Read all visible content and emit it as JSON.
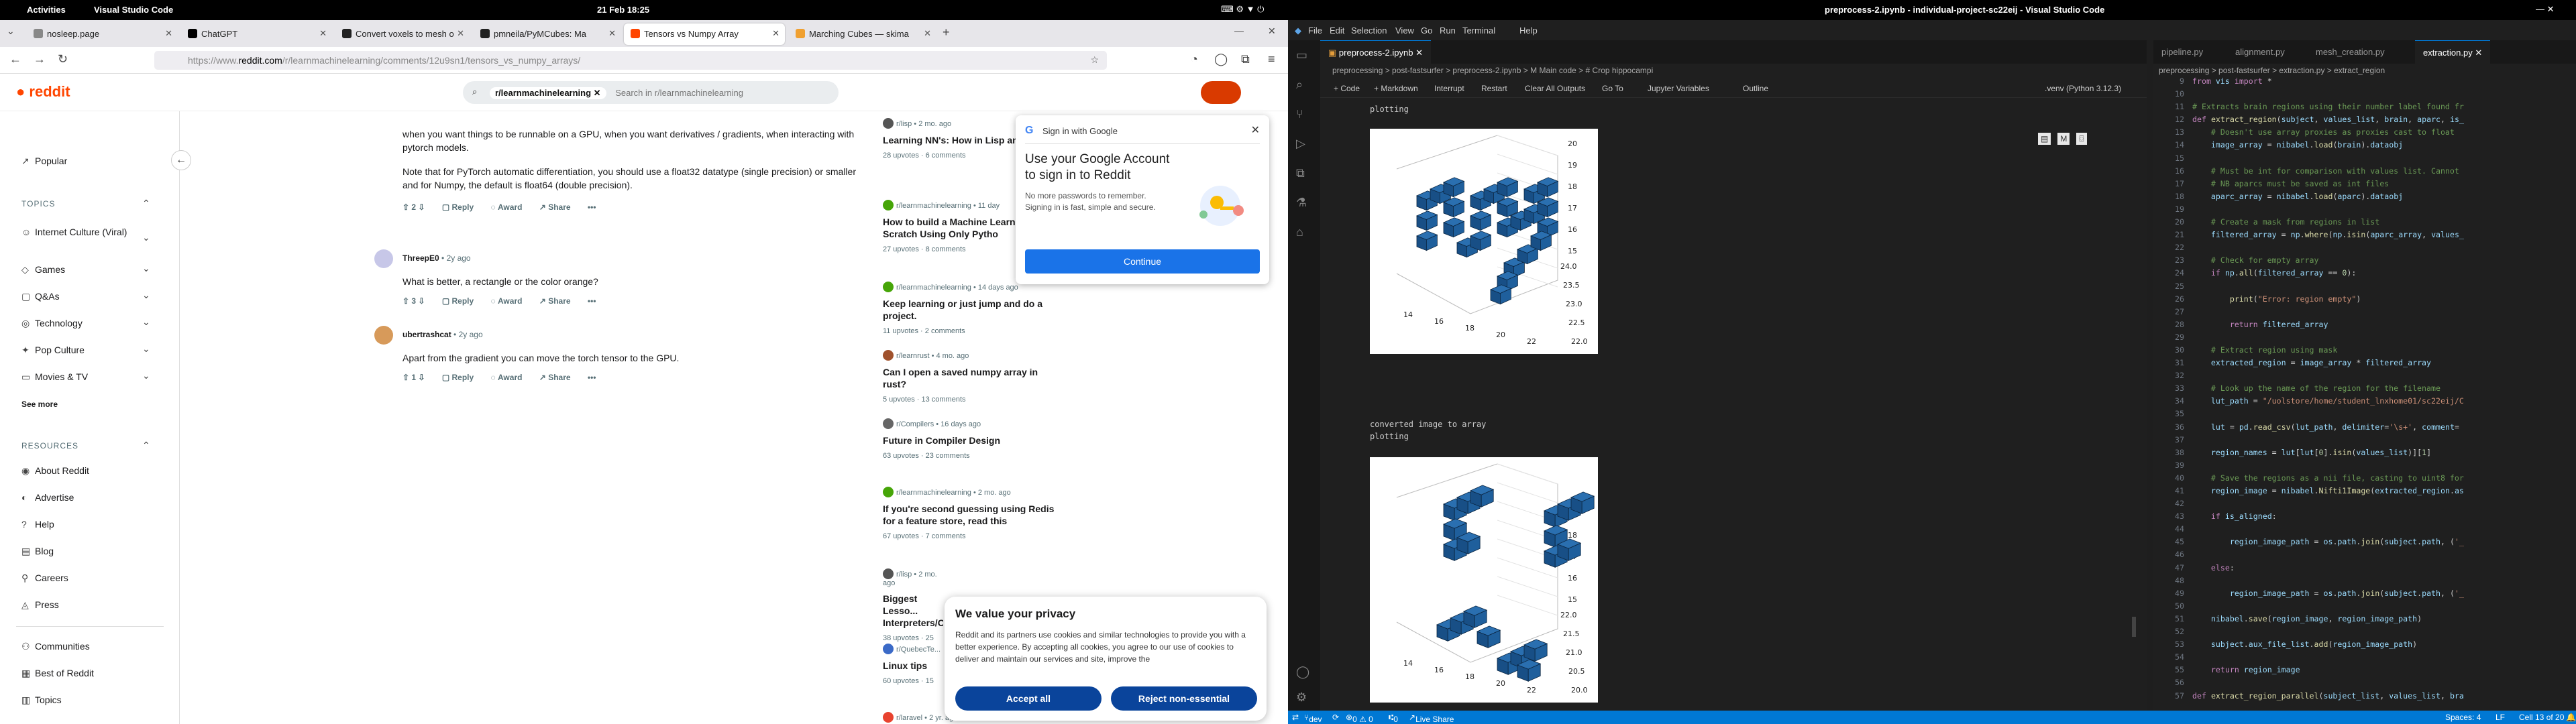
{
  "topbar": {
    "activities": "Activities",
    "app_name": "Visual Studio Code",
    "clock": "21 Feb  18:25",
    "window_title": "preprocess-2.ipynb - individual-project-sc22eij - Visual Studio Code"
  },
  "firefox": {
    "tabs": [
      {
        "label": "nosleep.page",
        "color": "#888"
      },
      {
        "label": "ChatGPT",
        "color": "#000"
      },
      {
        "label": "Convert voxels to mesh o",
        "color": "#222"
      },
      {
        "label": "pmneila/PyMCubes: Ma",
        "color": "#222"
      },
      {
        "label": "Tensors vs Numpy Array",
        "color": "#ff4500"
      },
      {
        "label": "Marching Cubes — skima",
        "color": "#f0a030"
      }
    ],
    "url_prefix": "https://www.",
    "url_domain": "reddit.com",
    "url_path": "/r/learnmachinelearning/comments/12u9sn1/tensors_vs_numpy_arrays/"
  },
  "reddit": {
    "logo": "reddit",
    "search_chip": "r/learnmachinelearning",
    "search_placeholder": "Search in r/learnmachinelearning",
    "sidebar": {
      "popular": "Popular",
      "topics_header": "TOPICS",
      "topics": [
        "Internet Culture (Viral)",
        "Games",
        "Q&As",
        "Technology",
        "Pop Culture",
        "Movies & TV"
      ],
      "see_more": "See more",
      "resources_header": "RESOURCES",
      "resources": [
        "About Reddit",
        "Advertise",
        "Help",
        "Blog",
        "Careers",
        "Press"
      ],
      "bottom": [
        "Communities",
        "Best of Reddit",
        "Topics"
      ]
    },
    "comments": [
      {
        "text1": "when you want things to be runnable on a GPU, when you want derivatives / gradients, when interacting with pytorch models.",
        "text2": "Note that for PyTorch automatic differentiation, you should use a float32 datatype (single precision) or smaller and for Numpy, the default is float64 (double precision).",
        "votes": "2"
      },
      {
        "author": "ThreepE0",
        "age": "• 2y ago",
        "text": "What is better, a rectangle or the color orange?",
        "votes": "3"
      },
      {
        "author": "ubertrashcat",
        "age": "• 2y ago",
        "text": "Apart from the gradient you can move the torch tensor to the GPU.",
        "votes": "1"
      }
    ],
    "actions": {
      "reply": "Reply",
      "award": "Award",
      "share": "Share",
      "more": "•••"
    },
    "related": [
      {
        "sub": "r/lisp • 2 mo. ago",
        "title": "Learning NN's: How in Lisp an... Lisp",
        "stats": "28 upvotes · 6 comments"
      },
      {
        "sub": "r/learnmachinelearning • 11 day",
        "title": "How to build a Machine Learn... from Scratch Using Only Pytho",
        "stats": "27 upvotes · 8 comments"
      },
      {
        "sub": "r/learnmachinelearning • 14 days ago",
        "title": "Keep learning or just jump and do a project.",
        "stats": "11 upvotes · 2 comments"
      },
      {
        "sub": "r/learnrust • 4 mo. ago",
        "title": "Can I open a saved numpy array in rust?",
        "stats": "5 upvotes · 13 comments"
      },
      {
        "sub": "r/Compilers • 16 days ago",
        "title": "Future in Compiler Design",
        "stats": "63 upvotes · 23 comments"
      },
      {
        "sub": "r/learnmachinelearning • 2 mo. ago",
        "title": "If you're second guessing using Redis for a feature store, read this",
        "stats": "67 upvotes · 7 comments"
      },
      {
        "sub": "r/lisp • 2 mo. ago",
        "title": "Biggest Lesso... Interpreters/C...",
        "stats": "38 upvotes · 25"
      },
      {
        "sub": "r/QuebecTe...",
        "title": "Linux tips",
        "stats": "60 upvotes · 15"
      },
      {
        "sub": "r/laravel • 2 yr. ago",
        "title": "",
        "stats": ""
      }
    ],
    "google": {
      "header": "Sign in with Google",
      "title": "Use your Google Account to sign in to Reddit",
      "body": "No more passwords to remember. Signing in is fast, simple and secure.",
      "button": "Continue"
    },
    "privacy": {
      "title": "We value your privacy",
      "body": "Reddit and its partners use cookies and similar technologies to provide you with a better experience. By accepting all cookies, you agree to our use of cookies to deliver and maintain our services and site, improve the",
      "accept": "Accept all",
      "reject": "Reject non-essential"
    }
  },
  "vscode": {
    "menu": [
      "File",
      "Edit",
      "Selection",
      "View",
      "Go",
      "Run",
      "Terminal",
      "Help"
    ],
    "tab_main": "preprocess-2.ipynb",
    "breadcrumbs": "preprocessing > post-fastsurfer > preprocess-2.ipynb > M Main code > # Crop hippocampi",
    "nbtoolbar": [
      "+ Code",
      "+ Markdown",
      "Interrupt",
      "Restart",
      "Clear All Outputs",
      "Go To",
      "Jupyter Variables",
      "Outline"
    ],
    "kernel": ".venv (Python 3.12.3)",
    "out1": "plotting",
    "out2a": "converted image to array",
    "out2b": "plotting",
    "plot1": {
      "y": [
        "14",
        "16",
        "18",
        "20",
        "22"
      ],
      "z": [
        "15",
        "16",
        "17",
        "18",
        "19",
        "20"
      ],
      "x": [
        "22.0",
        "22.5",
        "23.0",
        "23.5",
        "24.0"
      ]
    },
    "plot2": {
      "y": [
        "14",
        "16",
        "18",
        "20",
        "22"
      ],
      "z": [
        "15",
        "16",
        "17",
        "18",
        "19"
      ],
      "x": [
        "20.0",
        "20.5",
        "21.0",
        "21.5",
        "22.0"
      ]
    },
    "right_tabs": [
      "pipeline.py",
      "alignment.py",
      "mesh_creation.py",
      "extraction.py"
    ],
    "right_crumbs": "preprocessing > post-fastsurfer > extraction.py > extract_region",
    "status": {
      "branch": "dev",
      "errors": "0 ⚠ 0",
      "ports": "0",
      "live": "Live Share",
      "spaces": "Spaces: 4",
      "enc": "LF",
      "cell": "Cell 13 of 20"
    }
  }
}
